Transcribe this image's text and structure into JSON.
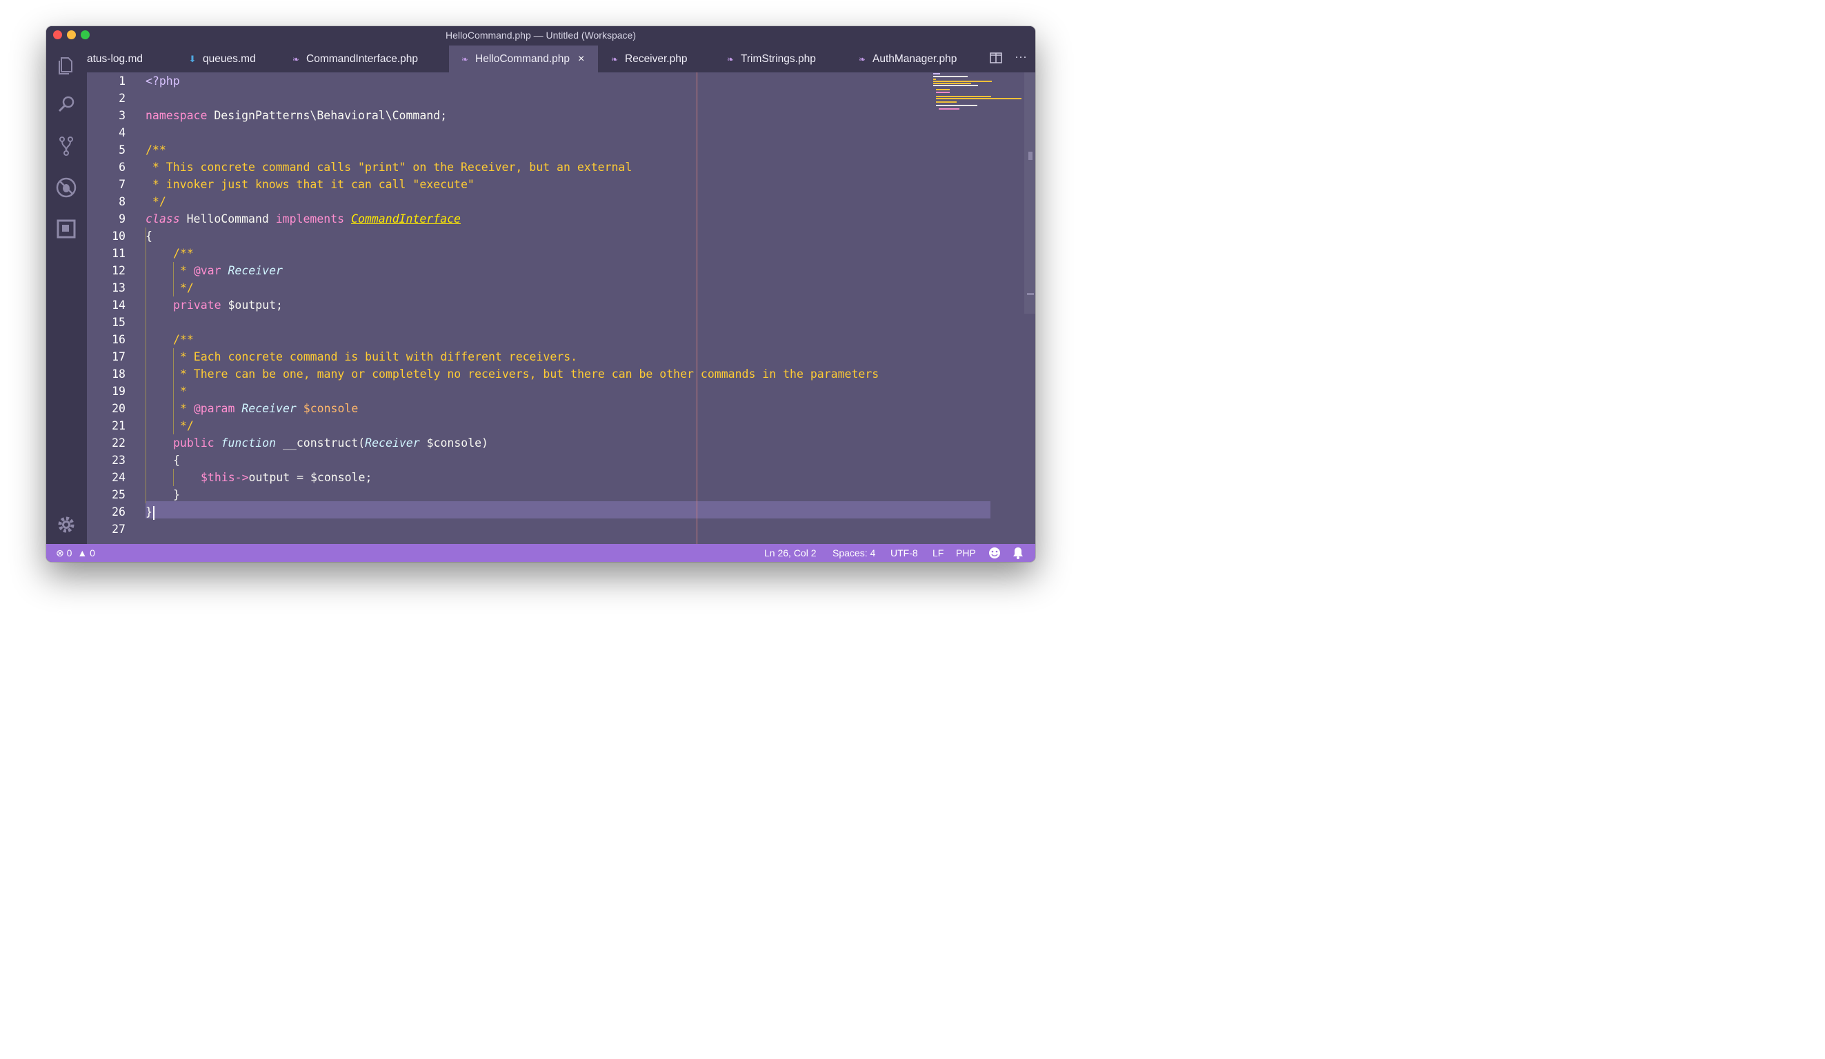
{
  "window": {
    "title": "HelloCommand.php — Untitled (Workspace)"
  },
  "activity_bar": {
    "items": [
      "files-icon",
      "search-icon",
      "source-control-icon",
      "debug-icon",
      "extensions-icon"
    ],
    "bottom": "gear-icon"
  },
  "tabs": [
    {
      "label": "atus-log.md",
      "icon": "markdown-icon",
      "active": false
    },
    {
      "label": "queues.md",
      "icon": "markdown-icon",
      "active": false
    },
    {
      "label": "CommandInterface.php",
      "icon": "php-icon",
      "active": false
    },
    {
      "label": "HelloCommand.php",
      "icon": "php-icon",
      "active": true,
      "close": "×"
    },
    {
      "label": "Receiver.php",
      "icon": "php-icon",
      "active": false
    },
    {
      "label": "TrimStrings.php",
      "icon": "php-icon",
      "active": false
    },
    {
      "label": "AuthManager.php",
      "icon": "php-icon",
      "active": false
    }
  ],
  "tab_actions": {
    "split": "split-editor-icon",
    "more": "···"
  },
  "editor": {
    "line_numbers": [
      "1",
      "2",
      "3",
      "4",
      "5",
      "6",
      "7",
      "8",
      "9",
      "10",
      "11",
      "12",
      "13",
      "14",
      "15",
      "16",
      "17",
      "18",
      "19",
      "20",
      "21",
      "22",
      "23",
      "24",
      "25",
      "26",
      "27"
    ],
    "current_line": 26,
    "code": {
      "l1": "<?php",
      "l3_kw": "namespace",
      "l3_rest": " DesignPatterns\\Behavioral\\Command;",
      "l5": "/**",
      "l6": " * This concrete command calls \"print\" on the Receiver, but an external",
      "l7": " * invoker just knows that it can call \"execute\"",
      "l8": " */",
      "l9_class": "class",
      "l9_name": " HelloCommand ",
      "l9_impl": "implements",
      "l9_space": " ",
      "l9_iface": "CommandInterface",
      "l10": "{",
      "l11": "/**",
      "l12_star": " * ",
      "l12_at": "@var",
      "l12_sp": " ",
      "l12_type": "Receiver",
      "l13": " */",
      "l14_kw": "private",
      "l14_rest": " $output;",
      "l16": "/**",
      "l17": " * Each concrete command is built with different receivers.",
      "l18": " * There can be one, many or completely no receivers, but there can be other commands in the parameters",
      "l19": " *",
      "l20_star": " * ",
      "l20_at": "@param",
      "l20_sp": " ",
      "l20_type": "Receiver",
      "l20_sp2": " ",
      "l20_var": "$console",
      "l22_pub": "public",
      "l22_sp": " ",
      "l22_fn": "function",
      "l22_name": " __construct(",
      "l22_type": "Receiver",
      "l22_rest": " $console)",
      "l23": "{",
      "l24_this": "$this",
      "l24_arrow": "->",
      "l24_prop": "output",
      "l24_eq": " = ",
      "l24_rest": "$console;",
      "l25": "}",
      "l26": "}"
    }
  },
  "status_bar": {
    "errors": "0",
    "warnings": "0",
    "position": "Ln 26, Col 2",
    "spaces": "Spaces: 4",
    "encoding": "UTF-8",
    "eol": "LF",
    "language": "PHP",
    "feedback": "smiley-icon",
    "notifications": "bell-icon"
  },
  "colors": {
    "editor_bg": "#5a5475",
    "sidebar_bg": "#3b3750",
    "status_bg": "#9a6fd8",
    "keyword": "#ff8fd0",
    "comment": "#ffcc33",
    "interface": "#ffea00"
  }
}
